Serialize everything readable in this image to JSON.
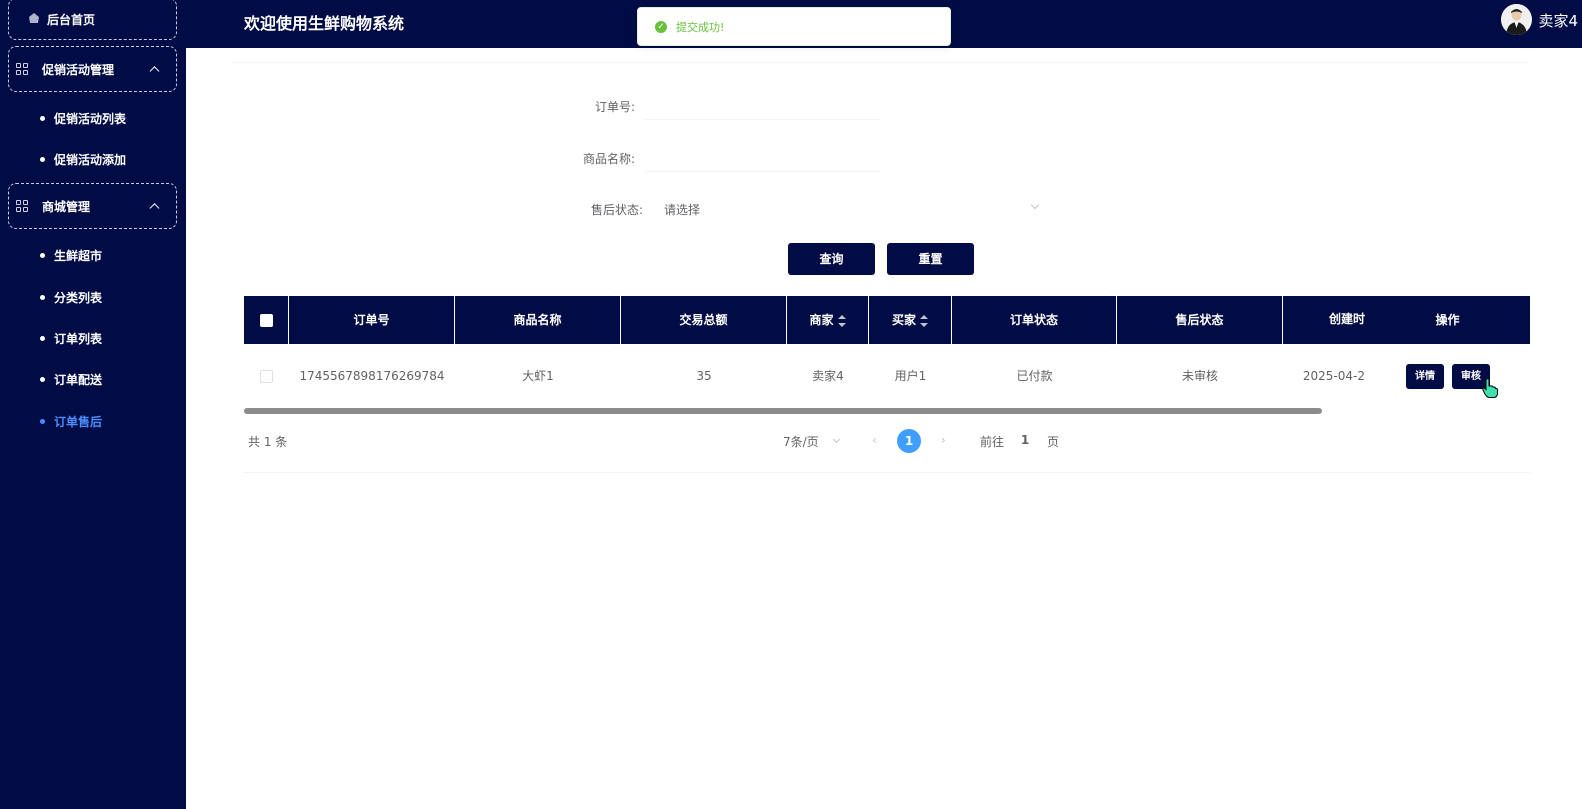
{
  "sidebar": {
    "home": "后台首页",
    "groups": [
      {
        "label": "促销活动管理",
        "items": [
          "促销活动列表",
          "促销活动添加"
        ]
      },
      {
        "label": "商城管理",
        "items": [
          "生鲜超市",
          "分类列表",
          "订单列表",
          "订单配送",
          "订单售后"
        ]
      }
    ],
    "active_item": "订单售后"
  },
  "header": {
    "title": "欢迎使用生鲜购物系统",
    "username": "卖家4"
  },
  "toast": {
    "message": "提交成功!",
    "color": "#67c23a"
  },
  "form": {
    "order_no_label": "订单号:",
    "order_no_value": "",
    "product_name_label": "商品名称:",
    "product_name_value": "",
    "aftersale_label": "售后状态:",
    "aftersale_placeholder": "请选择",
    "query_button": "查询",
    "reset_button": "重置"
  },
  "table": {
    "columns": [
      "订单号",
      "商品名称",
      "交易总额",
      "商家",
      "买家",
      "订单状态",
      "售后状态",
      "创建时",
      "操作"
    ],
    "rows": [
      {
        "order_no": "1745567898176269784",
        "product": "大虾1",
        "total": "35",
        "seller": "卖家4",
        "buyer": "用户1",
        "order_status": "已付款",
        "aftersale_status": "未审核",
        "created": "2025-04-2",
        "actions": [
          "详情",
          "审核"
        ]
      }
    ]
  },
  "pagination": {
    "total_text": "共 1 条",
    "page_size": "7条/页",
    "current_page": "1",
    "goto_label": "前往",
    "goto_value": "1",
    "page_unit": "页"
  },
  "colors": {
    "navy": "#010b45",
    "active_blue": "#4c8dff",
    "page_blue": "#409eff"
  }
}
